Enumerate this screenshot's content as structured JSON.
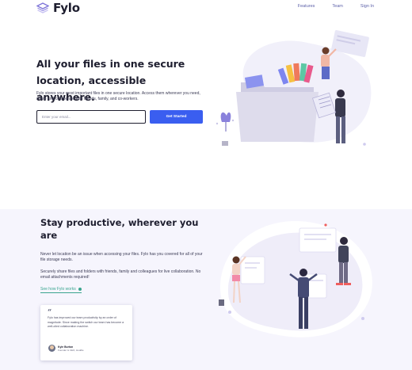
{
  "header": {
    "logo_text": "Fylo",
    "nav": [
      "Features",
      "Team",
      "Sign In"
    ]
  },
  "hero": {
    "title": "All your files in one secure location, accessible anywhere.",
    "description": "Fylo stores your most important files in one secure location. Access them wherever you need, share and collaborate with friends, family, and co-workers.",
    "email_placeholder": "Enter your email...",
    "cta_label": "Get Started"
  },
  "productive": {
    "title": "Stay productive, wherever you are",
    "paragraph1": "Never let location be an issue when accessing your files. Fylo has you covered for all of your file storage needs.",
    "paragraph2": "Securely share files and folders with friends, family and colleagues for live collaboration. No email attachments required!",
    "link_label": "See how Fylo works"
  },
  "testimonial": {
    "text": "Fylo has improved our team productivity by an order of magnitude. Since making the switch our team has become a well-oiled collaboration machine.",
    "author_name": "Kyle Burton",
    "author_role": "Founder & CEO, Huddle"
  },
  "colors": {
    "accent_blue": "#3a5ef0",
    "link_teal": "#3aa58f",
    "nav_purple": "#5b5fa8",
    "section_bg": "#f6f5fd"
  }
}
